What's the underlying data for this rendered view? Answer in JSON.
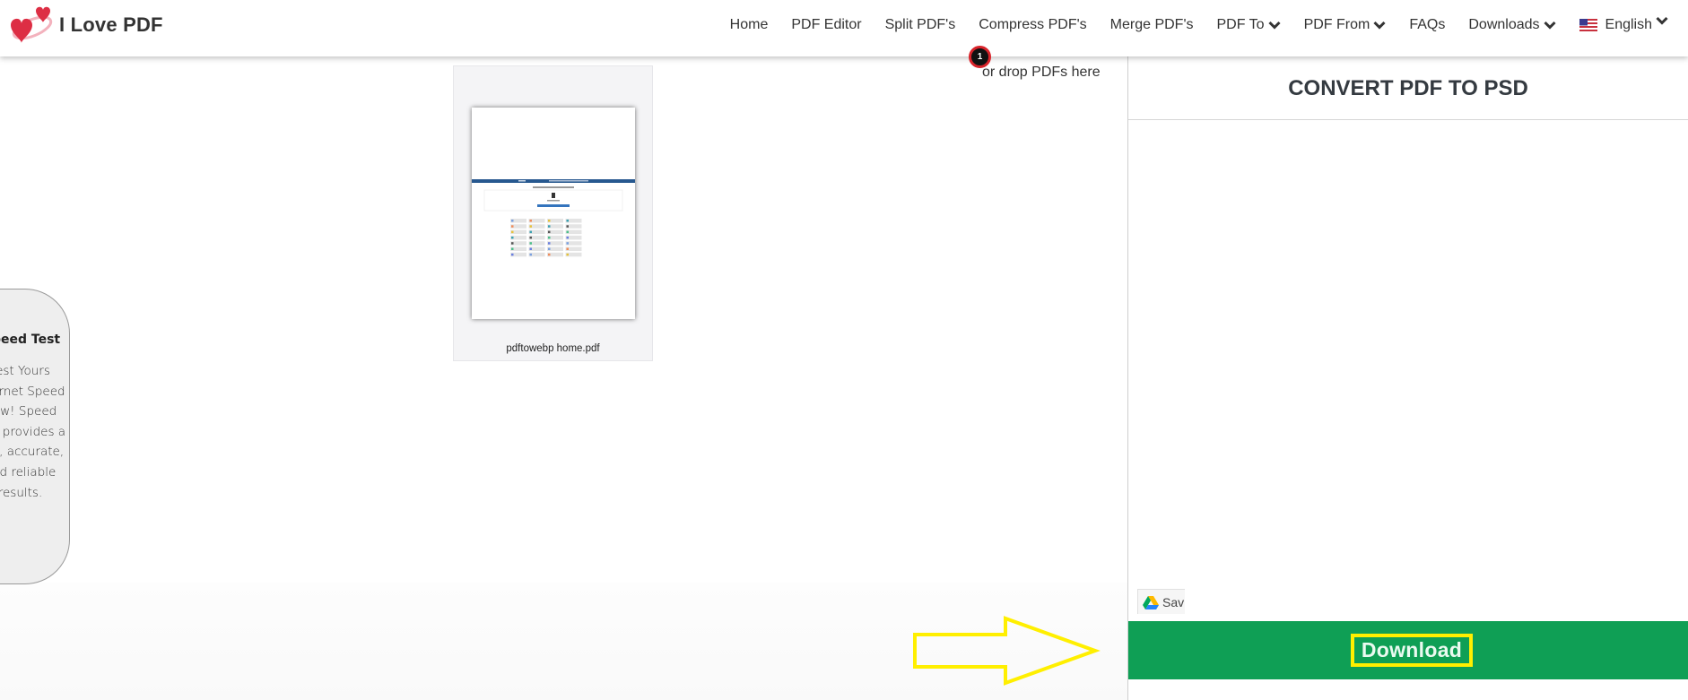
{
  "header": {
    "brand": "I Love PDF",
    "logo_icon": "two-hearts-icon",
    "nav": [
      {
        "label": "Home",
        "dropdown": false
      },
      {
        "label": "PDF Editor",
        "dropdown": false
      },
      {
        "label": "Split PDF's",
        "dropdown": false
      },
      {
        "label": "Compress PDF's",
        "dropdown": false
      },
      {
        "label": "Merge PDF's",
        "dropdown": false
      },
      {
        "label": "PDF To",
        "dropdown": true
      },
      {
        "label": "PDF From",
        "dropdown": true
      },
      {
        "label": "FAQs",
        "dropdown": false
      },
      {
        "label": "Downloads",
        "dropdown": true
      }
    ],
    "language": {
      "label": "English",
      "flag": "us-flag-icon"
    }
  },
  "upload": {
    "file_count_badge": "1",
    "drop_hint": "or drop PDFs here",
    "files": [
      {
        "name": "pdftowebp home.pdf"
      }
    ]
  },
  "speed_test_ad": {
    "title": "Speed Test",
    "description": "Test Yours Internet Speed Now! Speed Test provides a fast, accurate, and reliable results."
  },
  "panel": {
    "title": "CONVERT PDF TO PSD",
    "save_drive_label": "Save to Drive",
    "save_drive_visible_text": "Sav",
    "download_label": "Download"
  },
  "annotations": {
    "arrow_color": "#ffef00",
    "highlight_color": "#ffef00"
  },
  "colors": {
    "download_green": "#0f9f55",
    "badge_border": "#d8232a",
    "text_dark": "#343a40"
  }
}
